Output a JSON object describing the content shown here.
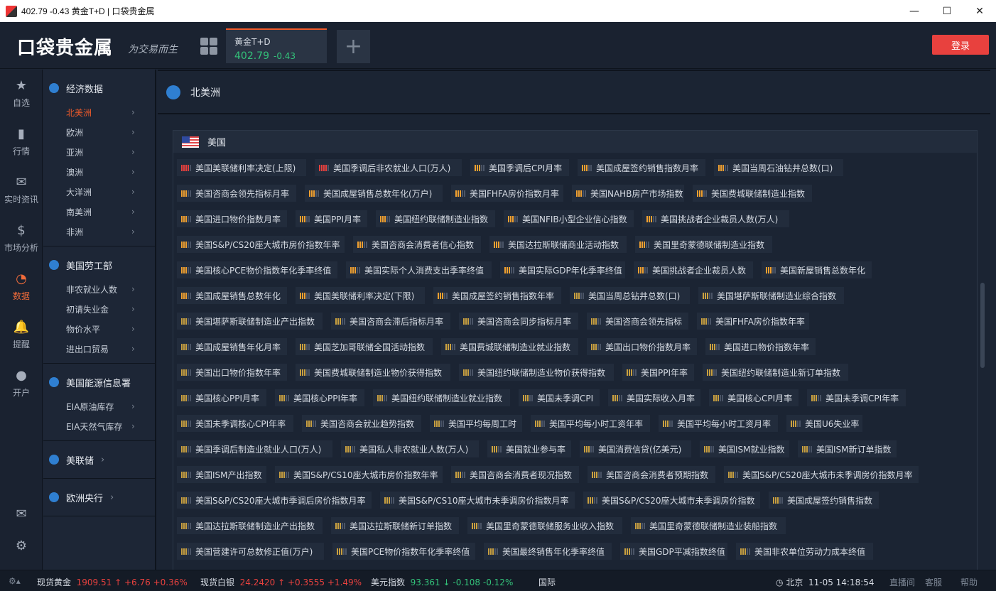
{
  "window": {
    "title": "402.79 -0.43 黄金T+D | 口袋贵金属"
  },
  "header": {
    "logo": "口袋贵金属",
    "slogan": "为交易而生",
    "tab": {
      "name": "黄金T+D",
      "price": "402.79",
      "change": "-0.43"
    },
    "add_tab": "+",
    "login": "登录"
  },
  "iconnav": [
    {
      "label": "自选",
      "icon": "star-icon"
    },
    {
      "label": "行情",
      "icon": "bar-chart-icon"
    },
    {
      "label": "实时资讯",
      "icon": "chat-icon"
    },
    {
      "label": "市场分析",
      "icon": "dollar-icon"
    },
    {
      "label": "数据",
      "icon": "pie-chart-icon",
      "active": true
    },
    {
      "label": "提醒",
      "icon": "bell-icon"
    },
    {
      "label": "开户",
      "icon": "user-icon"
    }
  ],
  "categories": {
    "econ": {
      "title": "经济数据",
      "items": [
        "北美洲",
        "欧洲",
        "亚洲",
        "澳洲",
        "大洋洲",
        "南美洲",
        "非洲"
      ]
    },
    "labor": {
      "title": "美国劳工部",
      "items": [
        "非农就业人数",
        "初请失业金",
        "物价水平",
        "进出口贸易"
      ]
    },
    "eia": {
      "title": "美国能源信息署",
      "items": [
        "EIA原油库存",
        "EIA天然气库存"
      ]
    },
    "fed": {
      "title": "美联储"
    },
    "ecb": {
      "title": "欧洲央行"
    }
  },
  "main": {
    "title": "北美洲",
    "country": "美国",
    "rows": [
      [
        [
          "美国美联储利率决定(上限)",
          3
        ],
        [
          "美国季调后非农就业人口(万人)",
          3
        ],
        [
          "美国季调后CPI月率",
          2
        ],
        [
          "美国成屋签约销售指数月率",
          2
        ],
        [
          "美国当周石油钻井总数(口)",
          2
        ]
      ],
      [
        [
          "美国咨商会领先指标月率",
          2
        ],
        [
          "美国成屋销售总数年化(万户)",
          2
        ],
        [
          "美国FHFA房价指数月率",
          2
        ],
        [
          "美国NAHB房产市场指数",
          2
        ],
        [
          "美国费城联储制造业指数",
          2
        ]
      ],
      [
        [
          "美国进口物价指数月率",
          2
        ],
        [
          "美国PPI月率",
          2
        ],
        [
          "美国纽约联储制造业指数",
          2
        ],
        [
          "美国NFIB小型企业信心指数",
          2
        ],
        [
          "美国挑战者企业裁员人数(万人)",
          2
        ]
      ],
      [
        [
          "美国S&P/CS20座大城市房价指数年率",
          2
        ],
        [
          "美国咨商会消费者信心指数",
          2
        ],
        [
          "美国达拉斯联储商业活动指数",
          2
        ],
        [
          "美国里奇蒙德联储制造业指数",
          2
        ]
      ],
      [
        [
          "美国核心PCE物价指数年化季率终值",
          2
        ],
        [
          "美国实际个人消费支出季率终值",
          2
        ],
        [
          "美国实际GDP年化季率终值",
          2
        ],
        [
          "美国挑战者企业裁员人数",
          2
        ],
        [
          "美国新屋销售总数年化",
          2
        ]
      ],
      [
        [
          "美国成屋销售总数年化",
          2
        ],
        [
          "美国美联储利率决定(下限)",
          2
        ],
        [
          "美国成屋签约销售指数年率",
          2
        ],
        [
          "美国当周总钻井总数(口)",
          1
        ],
        [
          "美国堪萨斯联储制造业综合指数",
          1
        ]
      ],
      [
        [
          "美国堪萨斯联储制造业产出指数",
          1
        ],
        [
          "美国咨商会滞后指标月率",
          1
        ],
        [
          "美国咨商会同步指标月率",
          1
        ],
        [
          "美国咨商会领先指标",
          1
        ],
        [
          "美国FHFA房价指数年率",
          1
        ]
      ],
      [
        [
          "美国成屋销售年化月率",
          1
        ],
        [
          "美国芝加哥联储全国活动指数",
          1
        ],
        [
          "美国费城联储制造业就业指数",
          1
        ],
        [
          "美国出口物价指数月率",
          1
        ],
        [
          "美国进口物价指数年率",
          1
        ]
      ],
      [
        [
          "美国出口物价指数年率",
          1
        ],
        [
          "美国费城联储制造业物价获得指数",
          1
        ],
        [
          "美国纽约联储制造业物价获得指数",
          1
        ],
        [
          "美国PPI年率",
          1
        ],
        [
          "美国纽约联储制造业新订单指数",
          1
        ]
      ],
      [
        [
          "美国核心PPI月率",
          1
        ],
        [
          "美国核心PPI年率",
          1
        ],
        [
          "美国纽约联储制造业就业指数",
          1
        ],
        [
          "美国未季调CPI",
          1
        ],
        [
          "美国实际收入月率",
          1
        ],
        [
          "美国核心CPI月率",
          1
        ],
        [
          "美国未季调CPI年率",
          1
        ]
      ],
      [
        [
          "美国未季调核心CPI年率",
          1
        ],
        [
          "美国咨商会就业趋势指数",
          1
        ],
        [
          "美国平均每周工时",
          1
        ],
        [
          "美国平均每小时工资年率",
          1
        ],
        [
          "美国平均每小时工资月率",
          1
        ],
        [
          "美国U6失业率",
          1
        ]
      ],
      [
        [
          "美国季调后制造业就业人口(万人)",
          1
        ],
        [
          "美国私人非农就业人数(万人)",
          1
        ],
        [
          "美国就业参与率",
          1
        ],
        [
          "美国消费信贷(亿美元)",
          1
        ],
        [
          "美国ISM就业指数",
          1
        ],
        [
          "美国ISM新订单指数",
          1
        ]
      ],
      [
        [
          "美国ISM产出指数",
          1
        ],
        [
          "美国S&P/CS10座大城市房价指数年率",
          1
        ],
        [
          "美国咨商会消费者现况指数",
          1
        ],
        [
          "美国咨商会消费者预期指数",
          1
        ],
        [
          "美国S&P/CS20座大城市未季调房价指数月率",
          1
        ]
      ],
      [
        [
          "美国S&P/CS20座大城市季调后房价指数月率",
          1
        ],
        [
          "美国S&P/CS10座大城市未季调房价指数月率",
          1
        ],
        [
          "美国S&P/CS20座大城市未季调房价指数",
          1
        ],
        [
          "美国成屋签约销售指数",
          1
        ]
      ],
      [
        [
          "美国达拉斯联储制造业产出指数",
          1
        ],
        [
          "美国达拉斯联储新订单指数",
          1
        ],
        [
          "美国里奇蒙德联储服务业收入指数",
          1
        ],
        [
          "美国里奇蒙德联储制造业装船指数",
          1
        ]
      ],
      [
        [
          "美国营建许可总数修正值(万户)",
          1
        ],
        [
          "美国PCE物价指数年化季率终值",
          1
        ],
        [
          "美国最终销售年化季率终值",
          1
        ],
        [
          "美国GDP平减指数终值",
          1
        ],
        [
          "美国非农单位劳动力成本终值",
          1
        ]
      ]
    ]
  },
  "statusbar": {
    "items": [
      {
        "name": "现货黄金",
        "price": "1909.51",
        "arrow": "↑",
        "chg": "+6.76",
        "pct": "+0.36%",
        "dir": "up"
      },
      {
        "name": "现货白银",
        "price": "24.2420",
        "arrow": "↑",
        "chg": "+0.3555",
        "pct": "+1.49%",
        "dir": "up"
      },
      {
        "name": "美元指数",
        "price": "93.361",
        "arrow": "↓",
        "chg": "-0.108",
        "pct": "-0.12%",
        "dir": "down"
      }
    ],
    "trailing": "国际",
    "clock_label": "北京",
    "clock": "11-05 14:18:54",
    "links": [
      "直播间",
      "客服",
      "帮助"
    ]
  },
  "colors": {
    "accent": "#f05a2a",
    "up": "#e8413e",
    "down": "#33c27a",
    "bar3": "#e8413e",
    "bar2": "#f0a030",
    "bar1": "#c9a040"
  }
}
